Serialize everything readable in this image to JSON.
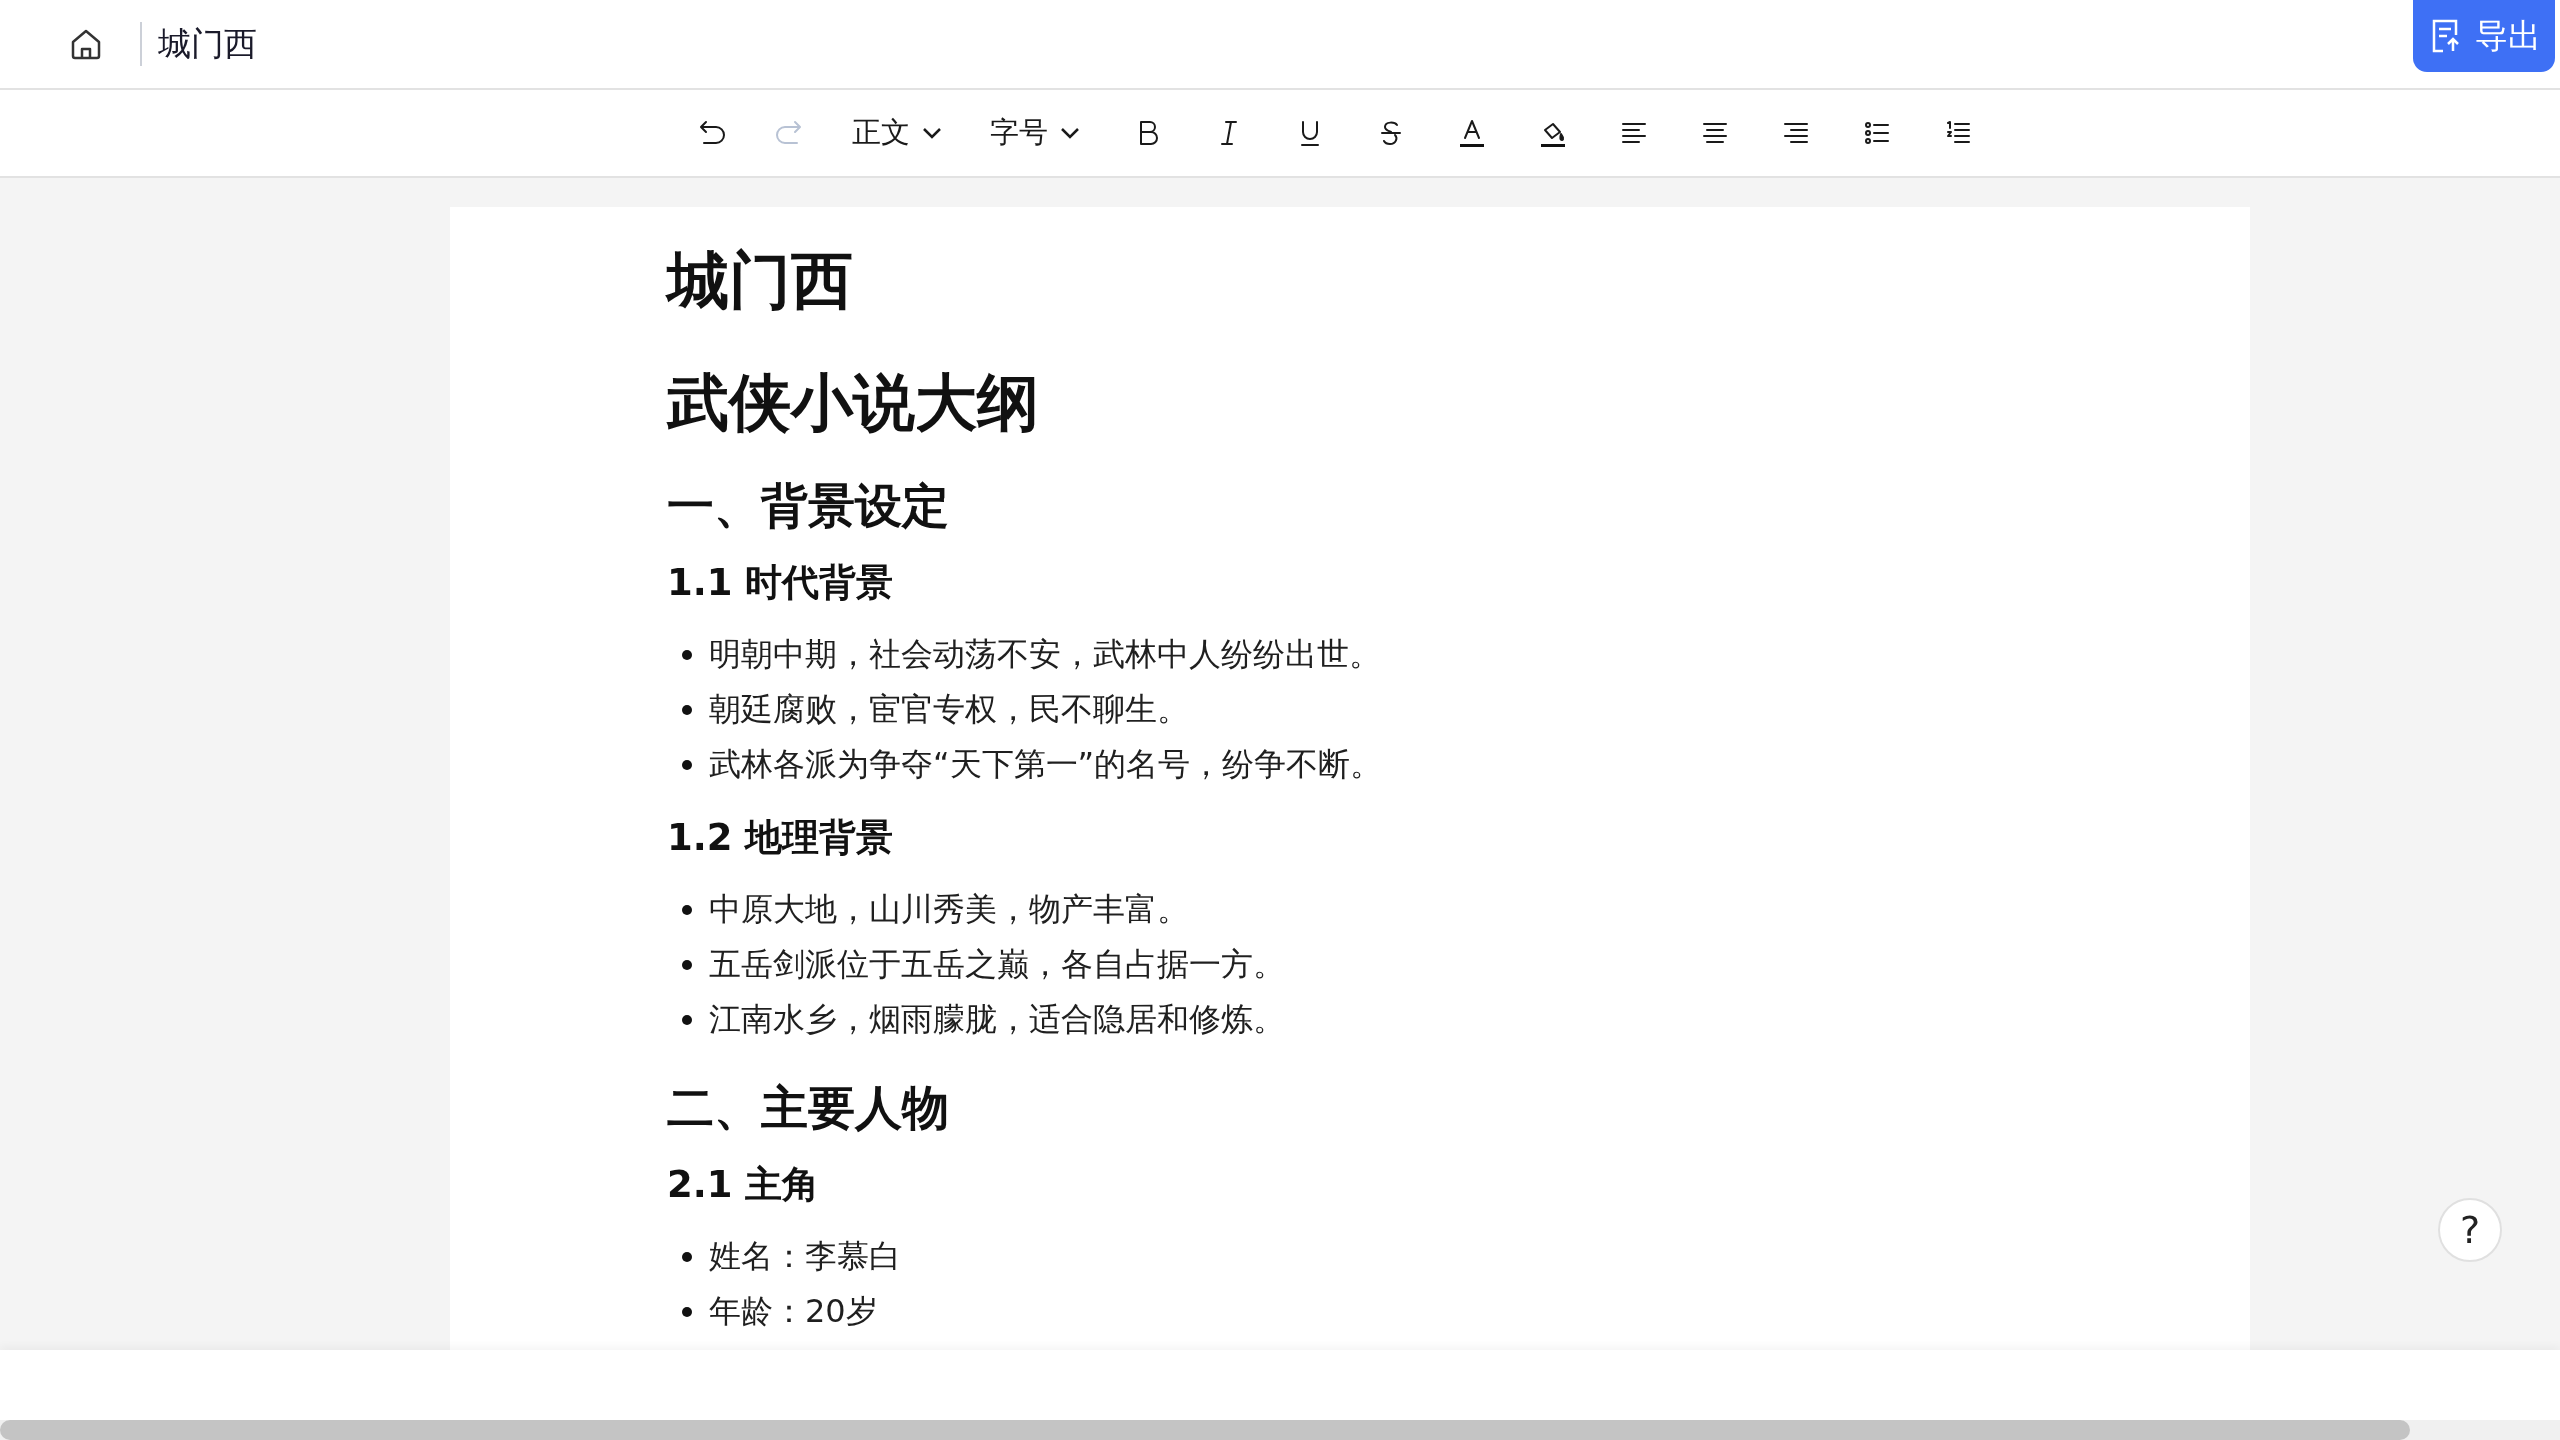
{
  "header": {
    "doc_title": "城门西",
    "export_button": "导出"
  },
  "toolbar": [
    {
      "kind": "icon",
      "disabled": false
    },
    {
      "kind": "icon",
      "disabled": true
    },
    {
      "kind": "dropdown",
      "label": "正文"
    },
    {
      "kind": "dropdown",
      "label": "字号"
    },
    {
      "kind": "icon",
      "disabled": false
    },
    {
      "kind": "icon",
      "disabled": false
    },
    {
      "kind": "icon",
      "disabled": false
    },
    {
      "kind": "icon",
      "disabled": false
    },
    {
      "kind": "icon",
      "disabled": false
    },
    {
      "kind": "icon",
      "disabled": false
    },
    {
      "kind": "icon",
      "disabled": false
    },
    {
      "kind": "icon",
      "disabled": false
    },
    {
      "kind": "icon",
      "disabled": false
    },
    {
      "kind": "icon",
      "disabled": false
    },
    {
      "kind": "icon",
      "disabled": false
    }
  ],
  "document": [
    {
      "kind": "title",
      "text": "城门西"
    },
    {
      "kind": "h1",
      "text": "武侠小说大纲"
    },
    {
      "kind": "h2",
      "text": "一、背景设定"
    },
    {
      "kind": "h3",
      "text": "1.1 时代背景"
    },
    {
      "kind": "list",
      "items": [
        "明朝中期，社会动荡不安，武林中人纷纷出世。",
        "朝廷腐败，宦官专权，民不聊生。",
        "武林各派为争夺“天下第一”的名号，纷争不断。"
      ]
    },
    {
      "kind": "h3",
      "text": "1.2 地理背景"
    },
    {
      "kind": "list",
      "items": [
        "中原大地，山川秀美，物产丰富。",
        "五岳剑派位于五岳之巅，各自占据一方。",
        "江南水乡，烟雨朦胧，适合隐居和修炼。"
      ]
    },
    {
      "kind": "h2",
      "text": "二、主要人物"
    },
    {
      "kind": "h3",
      "text": "2.1 主角"
    },
    {
      "kind": "list",
      "items": [
        "姓名：李慕白",
        "年龄：20岁"
      ]
    }
  ],
  "help_button": "?"
}
